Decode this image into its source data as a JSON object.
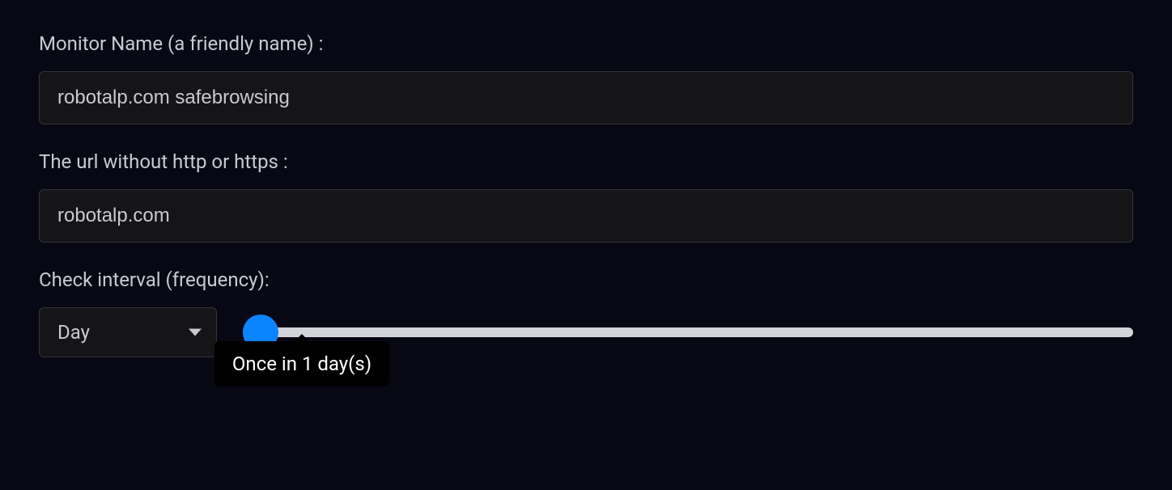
{
  "monitorName": {
    "label": "Monitor Name (a friendly name) :",
    "value": "robotalp.com safebrowsing"
  },
  "url": {
    "label": "The url without http or https :",
    "value": "robotalp.com"
  },
  "interval": {
    "label": "Check interval (frequency):",
    "unit": "Day",
    "tooltip": "Once in 1 day(s)"
  }
}
